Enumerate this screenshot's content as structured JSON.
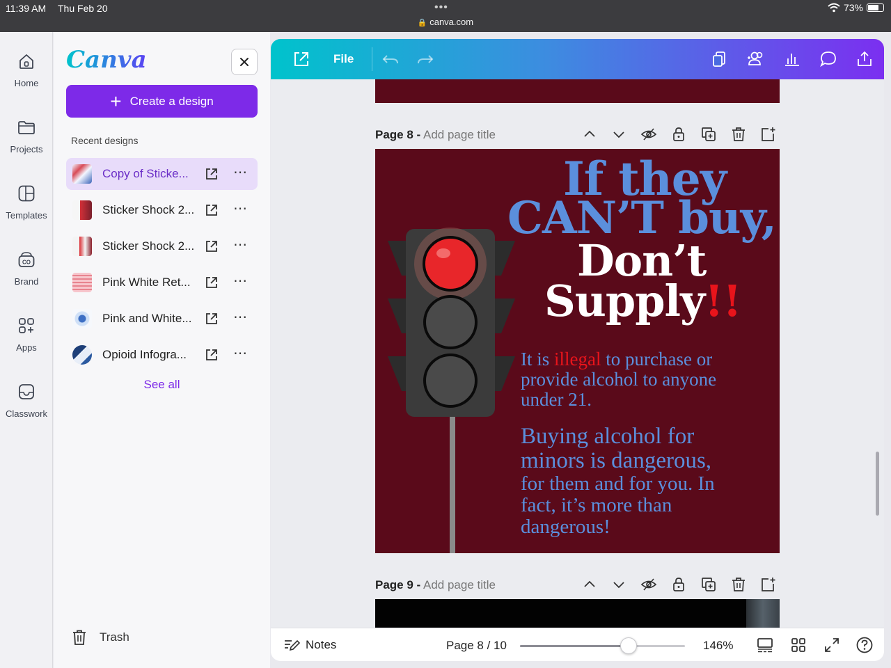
{
  "status_bar": {
    "time": "11:39 AM",
    "date": "Thu Feb 20",
    "dots": "•••",
    "url": "canva.com",
    "battery": "73%",
    "battery_level": 0.73
  },
  "nav_rail": {
    "items": [
      {
        "label": "Home",
        "icon": "home-icon"
      },
      {
        "label": "Projects",
        "icon": "folder-icon"
      },
      {
        "label": "Templates",
        "icon": "templates-icon"
      },
      {
        "label": "Brand",
        "icon": "brand-icon"
      },
      {
        "label": "Apps",
        "icon": "apps-icon"
      },
      {
        "label": "Classwork",
        "icon": "classwork-icon"
      }
    ]
  },
  "side_panel": {
    "logo": "Canva",
    "create_label": "Create a design",
    "recent_label": "Recent designs",
    "recent": [
      {
        "name": "Copy of Sticke...",
        "active": true
      },
      {
        "name": "Sticker Shock 2...",
        "active": false
      },
      {
        "name": "Sticker Shock 2...",
        "active": false
      },
      {
        "name": "Pink White Ret...",
        "active": false
      },
      {
        "name": "Pink and White...",
        "active": false
      },
      {
        "name": "Opioid Infogra...",
        "active": false
      }
    ],
    "see_all": "See all",
    "trash": "Trash"
  },
  "toolbar": {
    "file_label": "File"
  },
  "canvas": {
    "page8_title": "Page 8 -",
    "page8_placeholder": "Add page title",
    "page9_title": "Page 9 -",
    "page9_placeholder": "Add page title",
    "headline_1": "If they",
    "headline_2": "CAN’T buy,",
    "headline_3": "Don’t",
    "headline_4": "Supply",
    "headline_bang": "!!",
    "para1_a": "It is ",
    "para1_illegal": "illegal",
    "para1_b": " to purchase or",
    "para1_line2": "provide alcohol to anyone",
    "para1_line3": "under 21.",
    "para2_line1": "Buying alcohol for",
    "para2_line2": "minors is dangerous,",
    "para2_line3": "for them and for you. In",
    "para2_line4": "fact, it’s more than",
    "para2_line5": "dangerous!"
  },
  "bottom_bar": {
    "notes": "Notes",
    "page_indicator": "Page 8 / 10",
    "zoom": "146%",
    "zoom_slider_fraction": 0.66
  },
  "colors": {
    "brand_purple": "#7d2ae8",
    "page_bg": "#5a0a1a",
    "headline_blue": "#5b8fdc",
    "alert_red": "#e8141b"
  }
}
